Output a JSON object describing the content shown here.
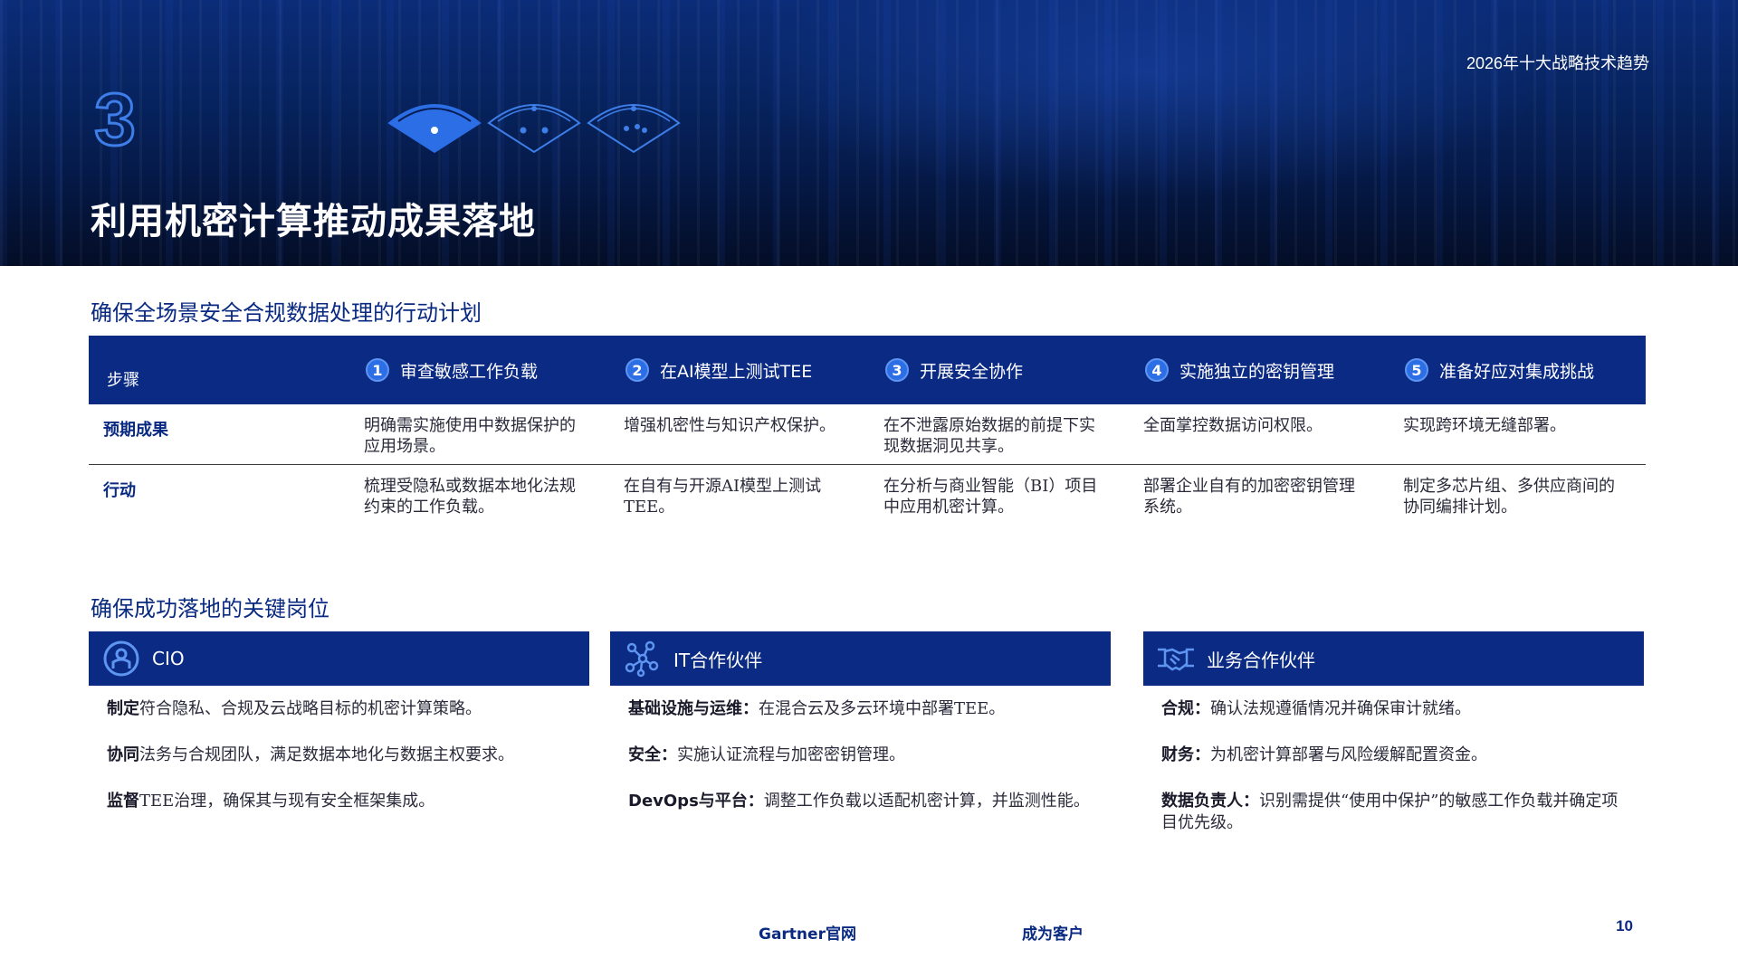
{
  "header": {
    "trend_label": "2026年十大战略技术趋势",
    "step_number": "3",
    "title": "利用机密计算推动成果落地"
  },
  "plan": {
    "heading": "确保全场景安全合规数据处理的行动计划",
    "steps_label": "步骤",
    "steps": [
      {
        "num": "1",
        "label": "审查敏感工作负载"
      },
      {
        "num": "2",
        "label": "在AI模型上测试TEE"
      },
      {
        "num": "3",
        "label": "开展安全协作"
      },
      {
        "num": "4",
        "label": "实施独立的密钥管理"
      },
      {
        "num": "5",
        "label": "准备好应对集成挑战"
      }
    ],
    "rows": [
      {
        "label": "预期成果",
        "cells": [
          "明确需实施使用中数据保护的应用场景。",
          "增强机密性与知识产权保护。",
          "在不泄露原始数据的前提下实现数据洞见共享。",
          "全面掌控数据访问权限。",
          "实现跨环境无缝部署。"
        ]
      },
      {
        "label": "行动",
        "cells": [
          "梳理受隐私或数据本地化法规约束的工作负载。",
          "在自有与开源AI模型上测试TEE。",
          "在分析与商业智能（BI）项目中应用机密计算。",
          "部署企业自有的加密密钥管理系统。",
          "制定多芯片组、多供应商间的协同编排计划。"
        ]
      }
    ]
  },
  "roles": {
    "heading": "确保成功落地的关键岗位",
    "cards": [
      {
        "title": "CIO",
        "icon": "cio-person-icon",
        "items": [
          {
            "kw": "制定",
            "text": "符合隐私、合规及云战略目标的机密计算策略。"
          },
          {
            "kw": "协同",
            "text": "法务与合规团队，满足数据本地化与数据主权要求。"
          },
          {
            "kw": "监督",
            "text": "TEE治理，确保其与现有安全框架集成。"
          }
        ]
      },
      {
        "title": "IT合作伙伴",
        "icon": "it-network-icon",
        "items": [
          {
            "kw": "基础设施与运维：",
            "text": "在混合云及多云环境中部署TEE。"
          },
          {
            "kw": "安全：",
            "text": "实施认证流程与加密密钥管理。"
          },
          {
            "kw": "DevOps与平台：",
            "text": "调整工作负载以适配机密计算，并监测性能。"
          }
        ]
      },
      {
        "title": "业务合作伙伴",
        "icon": "handshake-icon",
        "items": [
          {
            "kw": "合规：",
            "text": "确认法规遵循情况并确保审计就绪。"
          },
          {
            "kw": "财务：",
            "text": "为机密计算部署与风险缓解配置资金。"
          },
          {
            "kw": "数据负责人：",
            "text": "识别需提供“使用中保护”的敏感工作负载并确定项目优先级。"
          }
        ]
      }
    ]
  },
  "footer": {
    "link_site": "Gartner官网",
    "link_client": "成为客户",
    "page_number": "10"
  },
  "colors": {
    "brand_navy": "#0b2a84",
    "accent_blue": "#2b6ee6",
    "heading_blue": "#0a2a82"
  }
}
